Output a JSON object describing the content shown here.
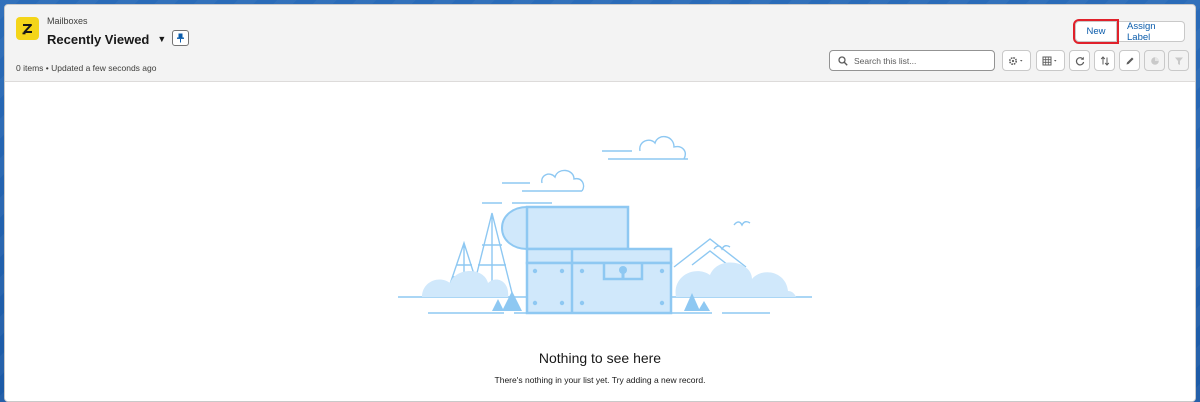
{
  "header": {
    "object_label": "Mailboxes",
    "list_view_title": "Recently Viewed",
    "status_text": "0 items • Updated a few seconds ago",
    "actions": {
      "new_label": "New",
      "assign_label": "Assign Label"
    },
    "search": {
      "placeholder": "Search this list..."
    }
  },
  "empty_state": {
    "title": "Nothing to see here",
    "subtitle": "There's nothing in your list yet. Try adding a new record."
  },
  "colors": {
    "accent": "#0b5cab",
    "icon_bg": "#f4d519",
    "highlight": "#e0212b",
    "illustration_stroke": "#8ec8f2",
    "illustration_fill": "#d0e8fb"
  },
  "icons": [
    "mailbox-icon",
    "pin-icon",
    "search-icon",
    "gear-icon",
    "table-icon",
    "refresh-icon",
    "sort-icon",
    "edit-icon",
    "chart-icon",
    "filter-icon"
  ]
}
